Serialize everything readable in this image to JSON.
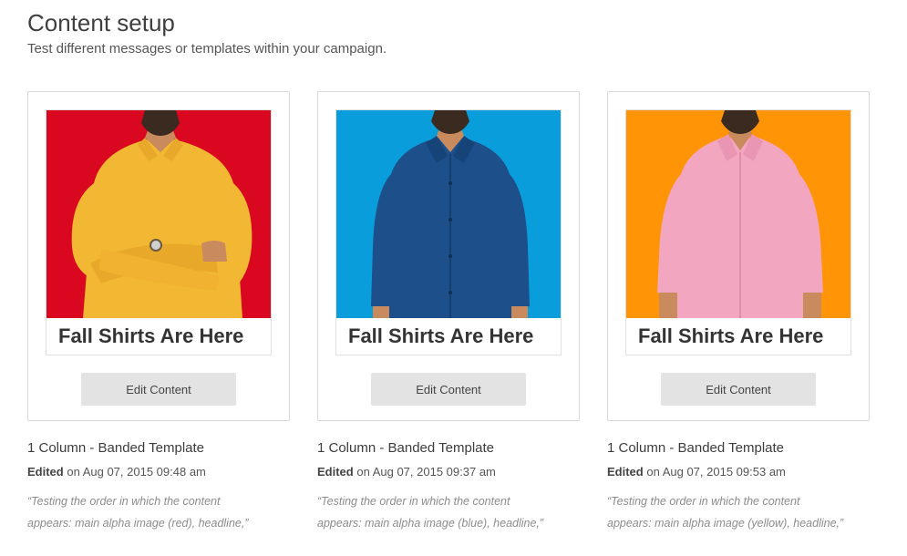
{
  "header": {
    "title": "Content setup",
    "subtitle": "Test different messages or templates within your campaign."
  },
  "variants": [
    {
      "headline": "Fall Shirts Are Here",
      "button_label": "Edit Content",
      "template_name": "1 Column - Banded Template",
      "edited_label": "Edited",
      "edited_date": "on Aug 07, 2015 09:48 am",
      "description_line1": "“Testing the order in which the content",
      "description_line2": "appears: main alpha image (red), headline,”",
      "background_color": "#d9071f",
      "shirt_color": "#f2b833"
    },
    {
      "headline": "Fall Shirts Are Here",
      "button_label": "Edit Content",
      "template_name": "1 Column - Banded Template",
      "edited_label": "Edited",
      "edited_date": "on Aug 07, 2015 09:37 am",
      "description_line1": "“Testing the order in which the content",
      "description_line2": "appears: main alpha image (blue), headline,”",
      "background_color": "#0a9ddc",
      "shirt_color": "#1d4f8a"
    },
    {
      "headline": "Fall Shirts Are Here",
      "button_label": "Edit Content",
      "template_name": "1 Column - Banded Template",
      "edited_label": "Edited",
      "edited_date": "on Aug 07, 2015 09:53 am",
      "description_line1": "“Testing the order in which the content",
      "description_line2": "appears: main alpha image (yellow), headline,”",
      "background_color": "#ff9407",
      "shirt_color": "#f2a6c0"
    }
  ]
}
